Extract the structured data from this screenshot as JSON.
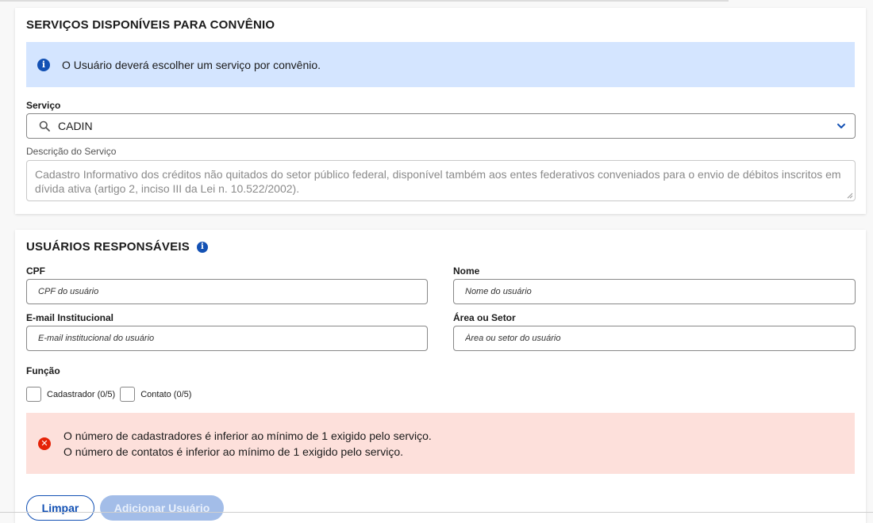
{
  "services": {
    "title": "SERVIÇOS DISPONÍVEIS PARA CONVÊNIO",
    "info_message": "O Usuário deverá escolher um serviço por convênio.",
    "service_label": "Serviço",
    "service_value": "CADIN",
    "description_label": "Descrição do Serviço",
    "description_text": "Cadastro Informativo dos créditos não quitados do setor público federal, disponível também aos entes federativos conveniados para o envio de débitos inscritos em dívida ativa (artigo 2, inciso III da Lei n. 10.522/2002)."
  },
  "users": {
    "title": "USUÁRIOS RESPONSÁVEIS",
    "cpf_label": "CPF",
    "cpf_placeholder": "CPF do usuário",
    "name_label": "Nome",
    "name_placeholder": "Nome do usuário",
    "email_label": "E-mail Institucional",
    "email_placeholder": "E-mail institucional do usuário",
    "area_label": "Área ou Setor",
    "area_placeholder": "Área ou setor do usuário",
    "role_label": "Função",
    "role_options": [
      {
        "label": "Cadastrador (0/5)",
        "checked": false
      },
      {
        "label": "Contato (0/5)",
        "checked": false
      }
    ],
    "errors": [
      "O número de cadastradores é inferior ao mínimo de 1 exigido pelo serviço.",
      "O número de contatos é inferior ao mínimo de 1 exigido pelo serviço."
    ],
    "clear_button": "Limpar",
    "add_button": "Adicionar Usuário"
  },
  "icons": {
    "info": "info-icon",
    "search": "search-icon",
    "chevron": "chevron-down-icon",
    "error": "error-icon"
  },
  "colors": {
    "primary": "#1351b4",
    "info_bg": "#d4e5ff",
    "error_bg": "#fde0db",
    "error_icon": "#e52207",
    "disabled_button": "#a3bde8"
  }
}
